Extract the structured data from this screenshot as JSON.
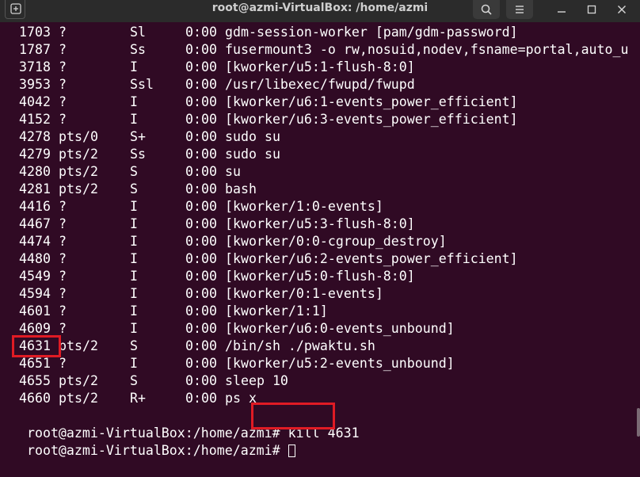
{
  "window": {
    "title": "root@azmi-VirtualBox: /home/azmi",
    "new_tab_icon": "new-tab-icon",
    "search_icon": "search-icon",
    "menu_icon": "hamburger-menu-icon"
  },
  "processes": [
    {
      "pid": "1703",
      "tty": "?",
      "stat": "Sl",
      "time": "0:00",
      "cmd": "gdm-session-worker [pam/gdm-password]"
    },
    {
      "pid": "1787",
      "tty": "?",
      "stat": "Ss",
      "time": "0:00",
      "cmd": "fusermount3 -o rw,nosuid,nodev,fsname=portal,auto_u"
    },
    {
      "pid": "3718",
      "tty": "?",
      "stat": "I",
      "time": "0:00",
      "cmd": "[kworker/u5:1-flush-8:0]"
    },
    {
      "pid": "3953",
      "tty": "?",
      "stat": "Ssl",
      "time": "0:00",
      "cmd": "/usr/libexec/fwupd/fwupd"
    },
    {
      "pid": "4042",
      "tty": "?",
      "stat": "I",
      "time": "0:00",
      "cmd": "[kworker/u6:1-events_power_efficient]"
    },
    {
      "pid": "4152",
      "tty": "?",
      "stat": "I",
      "time": "0:00",
      "cmd": "[kworker/u6:3-events_power_efficient]"
    },
    {
      "pid": "4278",
      "tty": "pts/0",
      "stat": "S+",
      "time": "0:00",
      "cmd": "sudo su"
    },
    {
      "pid": "4279",
      "tty": "pts/2",
      "stat": "Ss",
      "time": "0:00",
      "cmd": "sudo su"
    },
    {
      "pid": "4280",
      "tty": "pts/2",
      "stat": "S",
      "time": "0:00",
      "cmd": "su"
    },
    {
      "pid": "4281",
      "tty": "pts/2",
      "stat": "S",
      "time": "0:00",
      "cmd": "bash"
    },
    {
      "pid": "4416",
      "tty": "?",
      "stat": "I",
      "time": "0:00",
      "cmd": "[kworker/1:0-events]"
    },
    {
      "pid": "4467",
      "tty": "?",
      "stat": "I",
      "time": "0:00",
      "cmd": "[kworker/u5:3-flush-8:0]"
    },
    {
      "pid": "4474",
      "tty": "?",
      "stat": "I",
      "time": "0:00",
      "cmd": "[kworker/0:0-cgroup_destroy]"
    },
    {
      "pid": "4480",
      "tty": "?",
      "stat": "I",
      "time": "0:00",
      "cmd": "[kworker/u6:2-events_power_efficient]"
    },
    {
      "pid": "4549",
      "tty": "?",
      "stat": "I",
      "time": "0:00",
      "cmd": "[kworker/u5:0-flush-8:0]"
    },
    {
      "pid": "4594",
      "tty": "?",
      "stat": "I",
      "time": "0:00",
      "cmd": "[kworker/0:1-events]"
    },
    {
      "pid": "4601",
      "tty": "?",
      "stat": "I",
      "time": "0:00",
      "cmd": "[kworker/1:1]"
    },
    {
      "pid": "4609",
      "tty": "?",
      "stat": "I",
      "time": "0:00",
      "cmd": "[kworker/u6:0-events_unbound]"
    },
    {
      "pid": "4631",
      "tty": "pts/2",
      "stat": "S",
      "time": "0:00",
      "cmd": "/bin/sh ./pwaktu.sh"
    },
    {
      "pid": "4651",
      "tty": "?",
      "stat": "I",
      "time": "0:00",
      "cmd": "[kworker/u5:2-events_unbound]"
    },
    {
      "pid": "4655",
      "tty": "pts/2",
      "stat": "S",
      "time": "0:00",
      "cmd": "sleep 10"
    },
    {
      "pid": "4660",
      "tty": "pts/2",
      "stat": "R+",
      "time": "0:00",
      "cmd": "ps x"
    }
  ],
  "prompts": [
    {
      "prompt": "root@azmi-VirtualBox:/home/azmi#",
      "command": " kill 4631"
    },
    {
      "prompt": "root@azmi-VirtualBox:/home/azmi#",
      "command": " "
    }
  ],
  "highlights": {
    "color": "#e01b24",
    "pid_highlighted": "4631",
    "command_highlighted": "kill 4631"
  },
  "colors": {
    "terminal_bg": "#300a24",
    "titlebar_bg": "#2b2b2b",
    "text": "#ffffff"
  }
}
